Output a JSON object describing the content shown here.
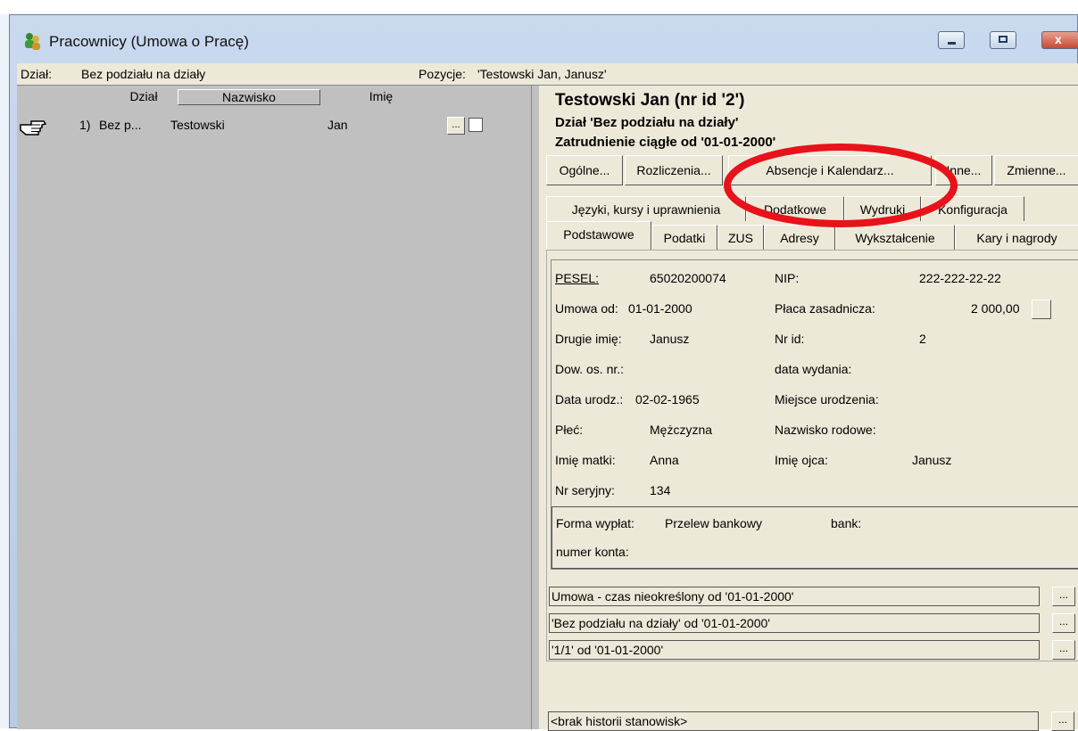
{
  "window": {
    "title": "Pracownicy (Umowa o Pracę)",
    "controls": [
      "minimize",
      "maximize",
      "close"
    ]
  },
  "infobar": {
    "dzial_label": "Dział:",
    "dzial_value": "Bez podziału na działy",
    "pozycja_label": "Pozycje:",
    "pozycja_value": "'Testowski Jan, Janusz'"
  },
  "list": {
    "headers": {
      "dzial": "Dział",
      "nazwisko": "Nazwisko",
      "imie": "Imię"
    },
    "rows": [
      {
        "num": "1)",
        "dzial": "Bez p...",
        "nazwisko": "Testowski",
        "imie": "Jan",
        "btn": "...",
        "checked": false
      }
    ]
  },
  "employee": {
    "title": "Testowski Jan (nr id '2')",
    "dept_line": "Dział 'Bez podziału na działy'",
    "employment_line": "Zatrudnienie ciągłe od '01-01-2000'"
  },
  "actions": [
    "Ogólne...",
    "Rozliczenia...",
    "Absencje i Kalendarz...",
    "Inne...",
    "Zmienne..."
  ],
  "tabs_row1": [
    "Języki, kursy i uprawnienia",
    "Dodatkowe",
    "Wydruki",
    "Konfiguracja"
  ],
  "tabs_row2": [
    "Podstawowe",
    "Podatki",
    "ZUS",
    "Adresy",
    "Wykształcenie",
    "Kary i nagrody"
  ],
  "details": {
    "pesel_label": "PESEL:",
    "pesel": "65020200074",
    "nip_label": "NIP:",
    "nip": "222-222-22-22",
    "umowa_label": "Umowa od:",
    "umowa": "01-01-2000",
    "placa_label": "Płaca zasadnicza:",
    "placa": "2 000,00",
    "drugie_label": "Drugie imię:",
    "drugie": "Janusz",
    "nrid_label": "Nr id:",
    "nrid": "2",
    "dow_label": "Dow. os. nr.:",
    "dow": "",
    "wydania_label": "data wydania:",
    "wydania": "",
    "urodz_label": "Data urodz.:",
    "urodz": "02-02-1965",
    "miejsce_label": "Miejsce urodzenia:",
    "miejsce": "",
    "plec_label": "Płeć:",
    "plec": "Mężczyzna",
    "rodowe_label": "Nazwisko rodowe:",
    "rodowe": "",
    "matki_label": "Imię matki:",
    "matki": "Anna",
    "ojca_label": "Imię ojca:",
    "ojca": "Janusz",
    "seryjny_label": "Nr seryjny:",
    "seryjny": "134"
  },
  "payment": {
    "forma_label": "Forma wypłat:",
    "forma": "Przelew bankowy",
    "bank_label": "bank:",
    "bank": "",
    "konto_label": "numer konta:",
    "konto": ""
  },
  "history": [
    "Umowa - czas nieokreślony od '01-01-2000'",
    "'Bez podziału na działy' od '01-01-2000'",
    "'1/1' od '01-01-2000'",
    "<brak historii stanowisk>"
  ],
  "history_btn": "...",
  "colors": {
    "highlight_ellipse": "#e8121a",
    "panel_bg": "#ece9d8",
    "list_bg": "#c0c0c0"
  },
  "icons": {
    "pointer": "hand-pointer-icon",
    "app": "people-icon"
  }
}
